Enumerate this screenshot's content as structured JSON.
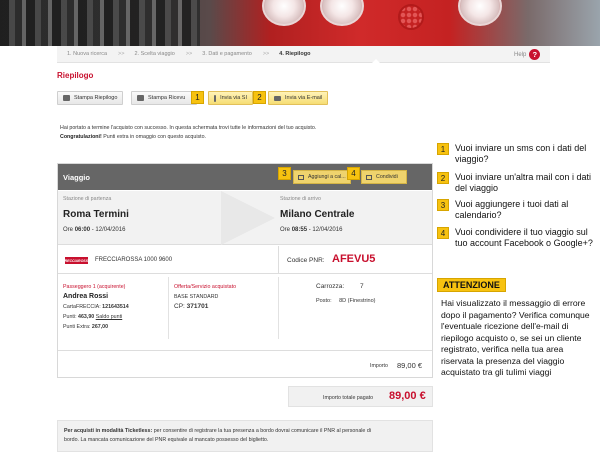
{
  "breadcrumb": {
    "steps": [
      "1. Nuova ricerca",
      "2. Scelta viaggio",
      "3. Dati e pagamento",
      "4. Riepilogo"
    ],
    "separator": ">>",
    "help": "Help",
    "help_icon": "?"
  },
  "page_title": "Riepilogo",
  "actions": {
    "print_summary": "Stampa Riepilogo",
    "print_receipt": "Stampa Ricevu",
    "send_sms": "Invia via SI",
    "send_email": "Invia via E-mail"
  },
  "markers": [
    "1",
    "2",
    "3",
    "4"
  ],
  "message": {
    "line1": "Hai portato a termine l'acquisto con successo. In questa schermata trovi tutte le informazioni del tuo acquisto.",
    "line2_bold": "Congratulazioni!",
    "line2_rest": " Punti extra in omaggio con questo acquisto."
  },
  "trip": {
    "title": "Viaggio",
    "add_calendar": "Aggiungi a cal...",
    "share": "Condividi",
    "departure_label": "Stazione di partenza",
    "departure_station": "Roma Termini",
    "departure_time_label": "Ore",
    "departure_time": "06:00",
    "departure_date": "12/04/2016",
    "arrival_label": "Stazione di arrivo",
    "arrival_station": "Milano Centrale",
    "arrival_time_label": "Ore",
    "arrival_time": "08:55",
    "arrival_date": "12/04/2016",
    "train_logo": "FRECCIAROSSA",
    "train": "FRECCIAROSSA 1000   9600",
    "pnr_label": "Codice PNR:",
    "pnr_value": "AFEVU5"
  },
  "passenger": {
    "label": "Passeggero 1",
    "role": "(acquirente)",
    "name": "Andrea  Rossi",
    "card_label": "CartaFRECCIA:",
    "card_number": "121643514",
    "points_label": "Punti:",
    "points_value": "463,90",
    "points_link": "Saldo punti",
    "extra_label": "Punti Extra:",
    "extra_value": "267,00"
  },
  "offer": {
    "label": "Offerta/Servizio acquistato",
    "base": "BASE STANDARD",
    "cp_label": "CP:",
    "cp_value": "371701"
  },
  "seat": {
    "carriage_label": "Carrozza:",
    "carriage_value": "7",
    "seat_label": "Posto:",
    "seat_value": "8D (Finestrino)"
  },
  "price": {
    "label": "Importo",
    "value": "89,00 €"
  },
  "total": {
    "label": "Importo totale pagato",
    "value": "89,00 €"
  },
  "notice": {
    "bold": "Per acquisti in modalità Ticketless:",
    "text1": " per consentire di registrare la tua presenza a bordo dovrai comunicare il PNR al personale di",
    "text2": "bordo. La mancata comunicazione del PNR equivale al mancato possesso del biglietto."
  },
  "callouts": [
    {
      "num": "1",
      "text": "Vuoi inviare un sms con i dati del viaggio?"
    },
    {
      "num": "2",
      "text": "Vuoi inviare un'altra mail con i dati del viaggio"
    },
    {
      "num": "3",
      "text": "Vuoi aggiungere i tuoi dati al calendario?"
    },
    {
      "num": "4",
      "text": "Vuoi condividere il tuo viaggio sul tuo account Facebook o Google+?"
    }
  ],
  "attention": {
    "label": "ATTENZIONE",
    "text": "Hai visualizzato il messaggio di errore dopo il pagamento? Verifica comunque l'eventuale ricezione dell'e-mail di riepilogo acquisto o, se sei un cliente registrato, verifica nella tua area riservata la presenza del viaggio acquistato tra gli tuIimi viaggi"
  },
  "colors": {
    "accent_red": "#c8102e",
    "marker_yellow": "#f7c210",
    "header_grey": "#666666"
  }
}
